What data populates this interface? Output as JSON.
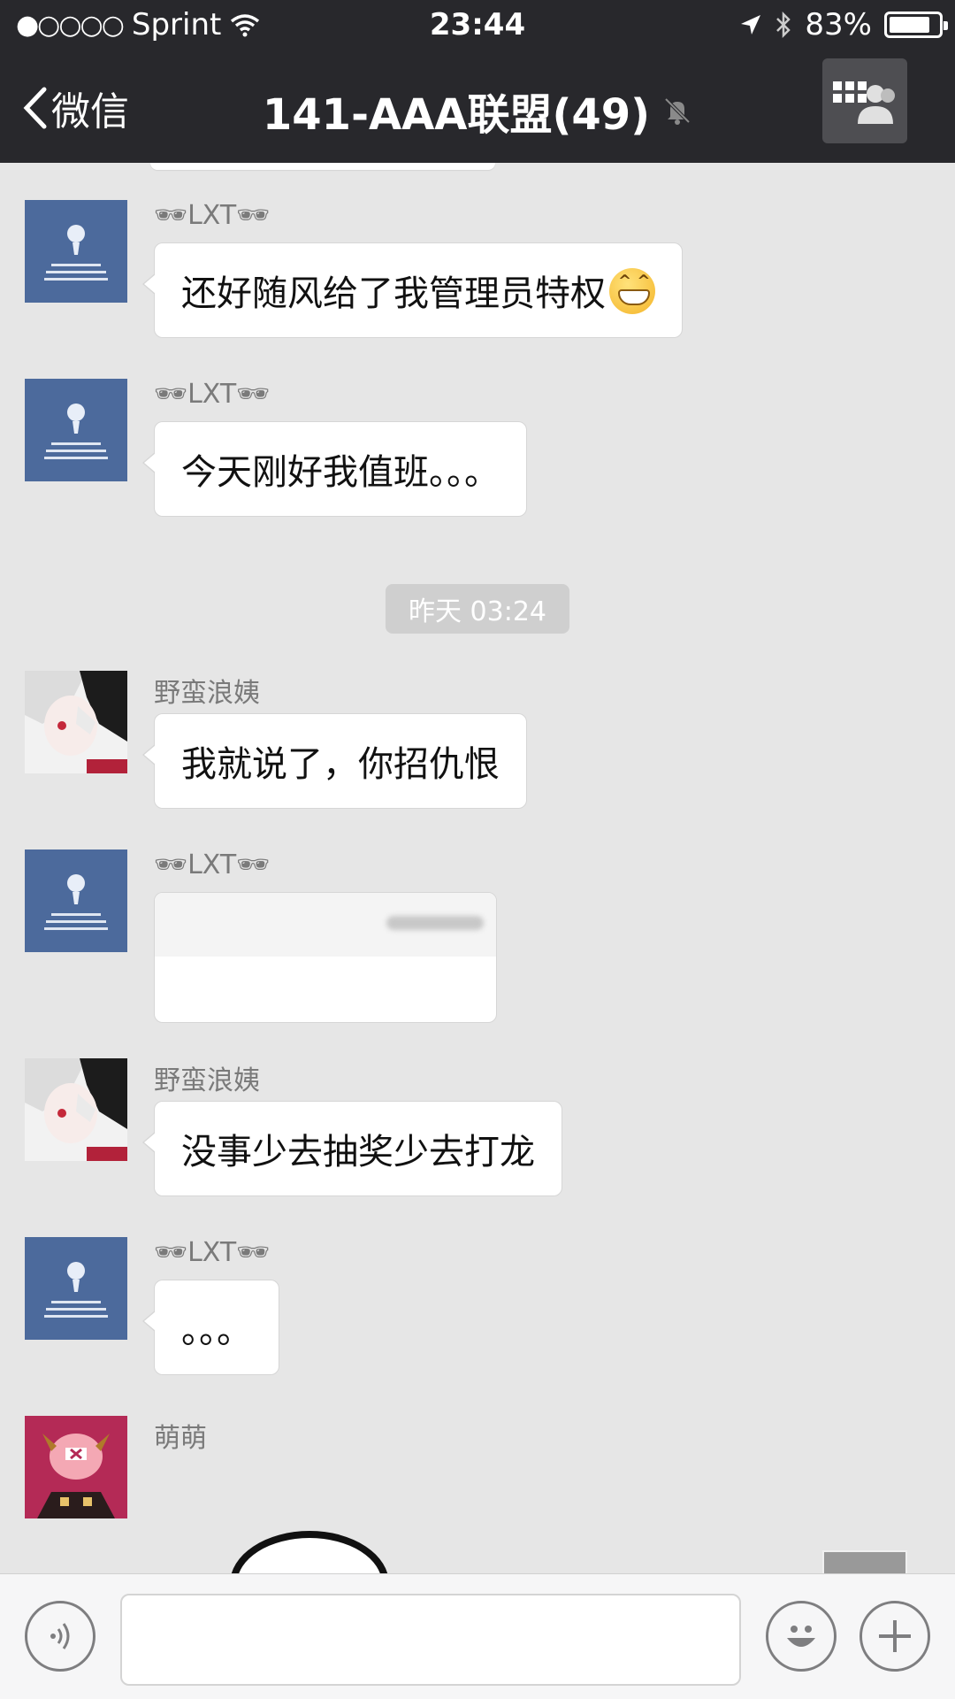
{
  "status_bar": {
    "signal": "●○○○○",
    "carrier": "Sprint",
    "time": "23:44",
    "battery": "83%",
    "battery_level": 0.83
  },
  "nav": {
    "back_label": "微信",
    "title": "141-AAA联盟(49)"
  },
  "messages": [
    {
      "sender": "🕶LXT🕶",
      "text": "还好随风给了我管理员特权",
      "avatar": "lxt"
    },
    {
      "sender": "🕶LXT🕶",
      "text": "今天刚好我值班。。。",
      "avatar": "lxt"
    },
    {
      "sender": "野蛮浪姨",
      "text": "我就说了，你招仇恨",
      "avatar": "yeman"
    },
    {
      "sender": "🕶LXT🕶",
      "text": "",
      "avatar": "lxt"
    },
    {
      "sender": "野蛮浪姨",
      "text": "没事少去抽奖少去打龙",
      "avatar": "yeman"
    },
    {
      "sender": "🕶LXT🕶",
      "text": "。。。",
      "avatar": "lxt"
    },
    {
      "sender": "萌萌",
      "text": "",
      "avatar": "mengmeng"
    }
  ],
  "timestamp": "昨天 03:24",
  "colors": {
    "nav_bg": "#28282c",
    "chat_bg": "#e6e6e6",
    "bubble_bg": "#ffffff",
    "sender_text": "#7a7a7a"
  }
}
